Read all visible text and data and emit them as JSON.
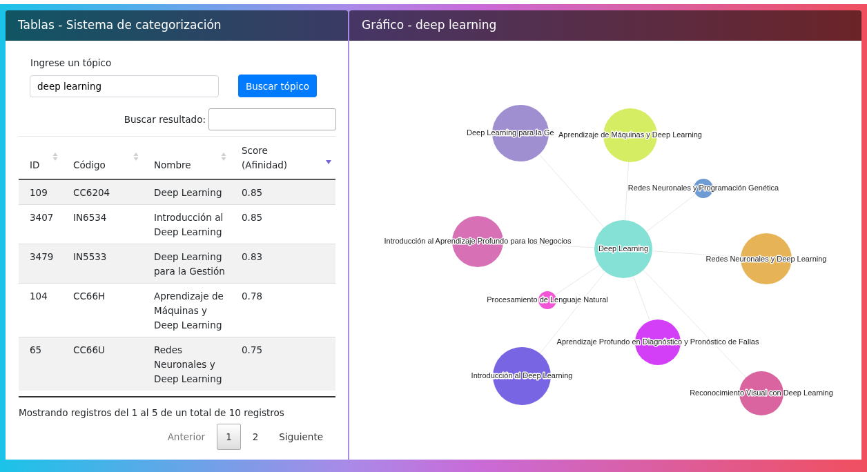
{
  "table_panel": {
    "title": "Tablas - Sistema de categorización",
    "topic_label": "Ingrese un tópico",
    "topic_value": "deep learning",
    "search_button": "Buscar tópico",
    "filter_label": "Buscar resultado:",
    "columns": [
      {
        "label": "ID",
        "sorted": false
      },
      {
        "label": "Código",
        "sorted": false
      },
      {
        "label": "Nombre",
        "sorted": false
      },
      {
        "label": "Score (Afinidad)",
        "sorted": true
      }
    ],
    "rows": [
      [
        "109",
        "CC6204",
        "Deep Learning",
        "0.85"
      ],
      [
        "3407",
        "IN6534",
        "Introducción al Deep Learning",
        "0.85"
      ],
      [
        "3479",
        "IN5533",
        "Deep Learning para la Gestión",
        "0.83"
      ],
      [
        "104",
        "CC66H",
        "Aprendizaje de Máquinas y Deep Learning",
        "0.78"
      ],
      [
        "65",
        "CC66U",
        "Redes Neuronales y Deep Learning",
        "0.75"
      ]
    ],
    "info": "Mostrando registros del 1 al 5 de un total de 10 registros",
    "pagination": [
      {
        "label": "Anterior",
        "disabled": true,
        "selected": false
      },
      {
        "label": "1",
        "disabled": false,
        "selected": true
      },
      {
        "label": "2",
        "disabled": false,
        "selected": false
      },
      {
        "label": "Siguiente",
        "disabled": false,
        "selected": false
      }
    ]
  },
  "graph_panel": {
    "title": "Gráfico - deep learning",
    "nodes": [
      {
        "label": "Deep Learning para la Ge",
        "color": "#a08fd0"
      },
      {
        "label": "Aprendizaje de Máquinas y Deep Learning",
        "color": "#d4ed62"
      },
      {
        "label": "Redes Neuronales y Programación Genética",
        "color": "#6f9bd4"
      },
      {
        "label": "Introducción al Aprendizaje Profundo para los Negocios",
        "color": "#d870b6"
      },
      {
        "label": "Deep Learning",
        "color": "#85e0d6"
      },
      {
        "label": "Redes Neuronales y Deep Learning",
        "color": "#e6b456"
      },
      {
        "label": "Procesamiento de Lenguaje Natural",
        "color": "#f255d5"
      },
      {
        "label": "Aprendizaje Profundo en Diagnóstico y Pronóstico de Fallas",
        "color": "#d23ff7"
      },
      {
        "label": "Introducción al Deep Learning",
        "color": "#7765e4"
      },
      {
        "label": "Reconocimiento Visual con Deep Learning",
        "color": "#d9649f"
      }
    ]
  }
}
